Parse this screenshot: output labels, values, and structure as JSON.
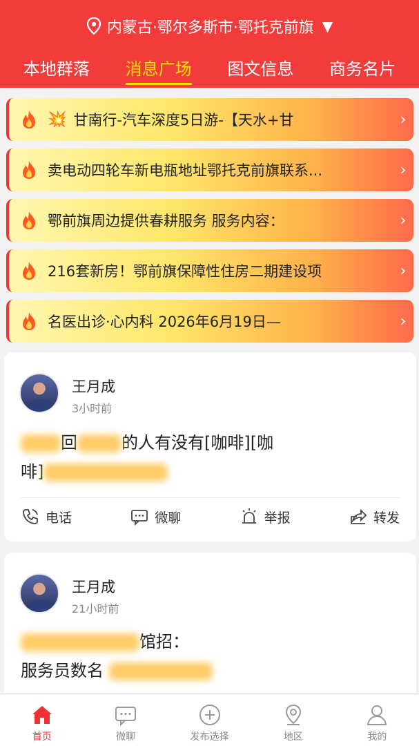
{
  "header": {
    "location": "内蒙古·鄂尔多斯市·鄂托克前旗",
    "tabs": [
      {
        "label": "本地群落",
        "active": false
      },
      {
        "label": "消息广场",
        "active": true
      },
      {
        "label": "图文信息",
        "active": false
      },
      {
        "label": "商务名片",
        "active": false
      }
    ]
  },
  "news": [
    {
      "text": "甘南行-汽车深度5日游-【天水+甘",
      "has_boom": true
    },
    {
      "text": "卖电动四轮车新电瓶地址鄂托克前旗联系...",
      "has_boom": false
    },
    {
      "text": "鄂前旗周边提供春耕服务 服务内容：",
      "has_boom": false
    },
    {
      "text": "216套新房！鄂前旗保障性住房二期建设项",
      "has_boom": false
    },
    {
      "text": "名医出诊·心内科 2026年6月19日—",
      "has_boom": false
    }
  ],
  "posts": [
    {
      "name": "王月成",
      "time": "3小时前",
      "line1_visible": "回",
      "line1_visible2": "的人有没有[咖啡][咖",
      "line2_visible": "啡]"
    },
    {
      "name": "王月成",
      "time": "21小时前",
      "line1_visible": "馆招：",
      "line2_visible": "服务员数名"
    }
  ],
  "actions": {
    "phone": "电话",
    "chat": "微聊",
    "report": "举报",
    "share": "转发"
  },
  "tabbar": [
    {
      "label": "首页",
      "active": true,
      "icon": "home-icon"
    },
    {
      "label": "微聊",
      "active": false,
      "icon": "chat-icon"
    },
    {
      "label": "发布选择",
      "active": false,
      "icon": "plus-circle-icon"
    },
    {
      "label": "地区",
      "active": false,
      "icon": "location-icon"
    },
    {
      "label": "我的",
      "active": false,
      "icon": "user-icon"
    }
  ],
  "colors": {
    "primary": "#f23c3c",
    "active_tab": "#ffe100"
  }
}
